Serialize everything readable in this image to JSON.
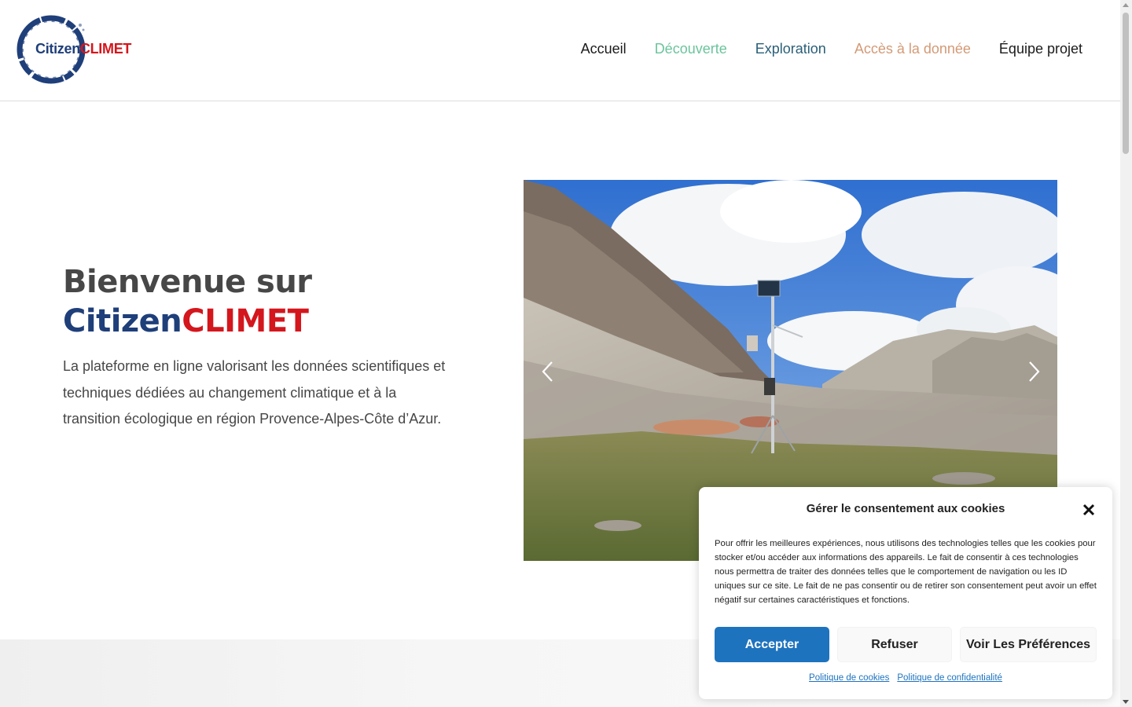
{
  "brand": {
    "part1": "Citizen",
    "part2": "CLIMET"
  },
  "nav": [
    {
      "label": "Accueil"
    },
    {
      "label": "Découverte"
    },
    {
      "label": "Exploration"
    },
    {
      "label": "Accès à la donnée"
    },
    {
      "label": "Équipe projet"
    }
  ],
  "hero": {
    "title_line1": "Bienvenue sur",
    "title_part1": "Citizen",
    "title_part2": "CLIMET",
    "description": "La plateforme en ligne valorisant les données scientifiques et techniques dédiées au changement climatique et à la transition écologique en région Provence-Alpes-Côte d’Azur."
  },
  "slider": {
    "prev_icon": "chevron-left-icon",
    "next_icon": "chevron-right-icon"
  },
  "cookie": {
    "title": "Gérer le consentement aux cookies",
    "text": "Pour offrir les meilleures expériences, nous utilisons des technologies telles que les cookies pour stocker et/ou accéder aux informations des appareils. Le fait de consentir à ces technologies nous permettra de traiter des données telles que le comportement de navigation ou les ID uniques sur ce site. Le fait de ne pas consentir ou de retirer son consentement peut avoir un effet négatif sur certaines caractéristiques et fonctions.",
    "accept": "Accepter",
    "refuse": "Refuser",
    "preferences": "Voir Les Préférences",
    "link_cookies": "Politique de cookies",
    "link_privacy": "Politique de confidentialité"
  },
  "colors": {
    "brand_blue": "#1f3f7a",
    "brand_red": "#d4161d",
    "accept_button": "#1e73be",
    "nav_decouverte": "#6bc49c",
    "nav_exploration": "#2a5f78",
    "nav_acces": "#d39a76"
  }
}
